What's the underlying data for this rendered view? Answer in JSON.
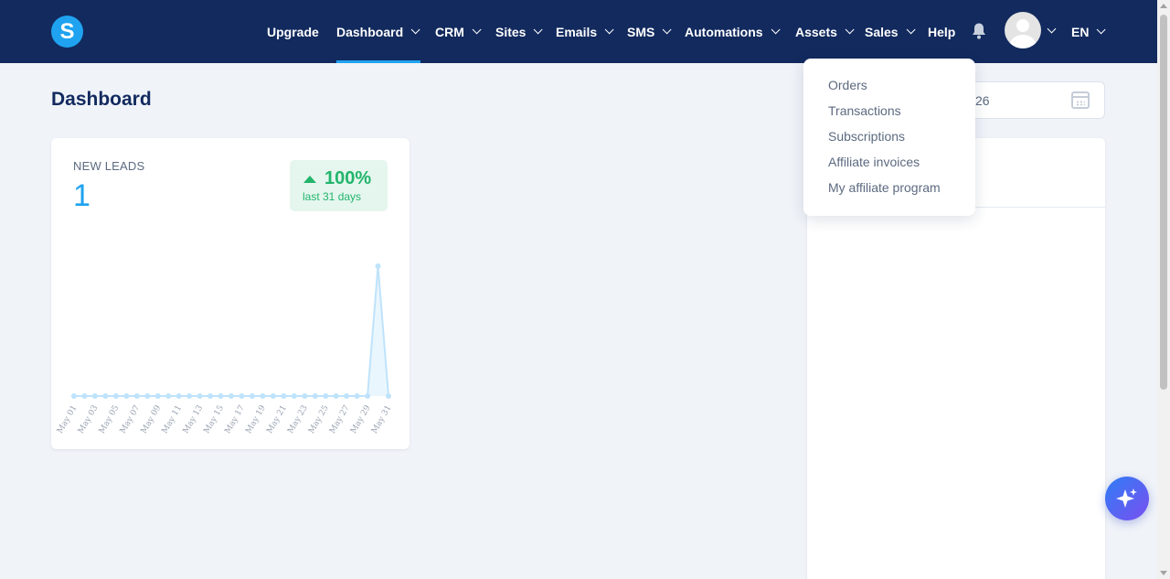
{
  "brand": {
    "logo_letter": "S",
    "accent": "#1fa3f0",
    "nav_bg": "#122a5e"
  },
  "nav": {
    "upgrade": "Upgrade",
    "dashboard": "Dashboard",
    "crm": "CRM",
    "sites": "Sites",
    "emails": "Emails",
    "sms": "SMS",
    "automations": "Automations",
    "assets": "Assets",
    "sales": "Sales",
    "help": "Help",
    "language": "EN"
  },
  "page": {
    "title": "Dashboard"
  },
  "leads_card": {
    "label": "NEW LEADS",
    "value": "1",
    "change": "100%",
    "change_period": "last 31 days",
    "change_color": "#22b56c"
  },
  "date_range": {
    "visible_text": "26"
  },
  "sales_menu": {
    "items": [
      "Orders",
      "Transactions",
      "Subscriptions",
      "Affiliate invoices",
      "My affiliate program"
    ]
  },
  "chart_data": {
    "type": "area",
    "title": "",
    "xlabel": "",
    "ylabel": "",
    "x_tick_labels": [
      "May 01",
      "May 03",
      "May 05",
      "May 07",
      "May 09",
      "May 11",
      "May 13",
      "May 15",
      "May 17",
      "May 19",
      "May 21",
      "May 23",
      "May 25",
      "May 27",
      "May 29",
      "May 31"
    ],
    "x": [
      "May 01",
      "May 02",
      "May 03",
      "May 04",
      "May 05",
      "May 06",
      "May 07",
      "May 08",
      "May 09",
      "May 10",
      "May 11",
      "May 12",
      "May 13",
      "May 14",
      "May 15",
      "May 16",
      "May 17",
      "May 18",
      "May 19",
      "May 20",
      "May 21",
      "May 22",
      "May 23",
      "May 24",
      "May 25",
      "May 26",
      "May 27",
      "May 28",
      "May 29",
      "May 30",
      "May 31"
    ],
    "series": [
      {
        "values": [
          0,
          0,
          0,
          0,
          0,
          0,
          0,
          0,
          0,
          0,
          0,
          0,
          0,
          0,
          0,
          0,
          0,
          0,
          0,
          0,
          0,
          0,
          0,
          0,
          0,
          0,
          0,
          0,
          0,
          1,
          0
        ]
      }
    ],
    "ylim": [
      0,
      1
    ],
    "grid": false,
    "color": "#bfe3fb"
  }
}
